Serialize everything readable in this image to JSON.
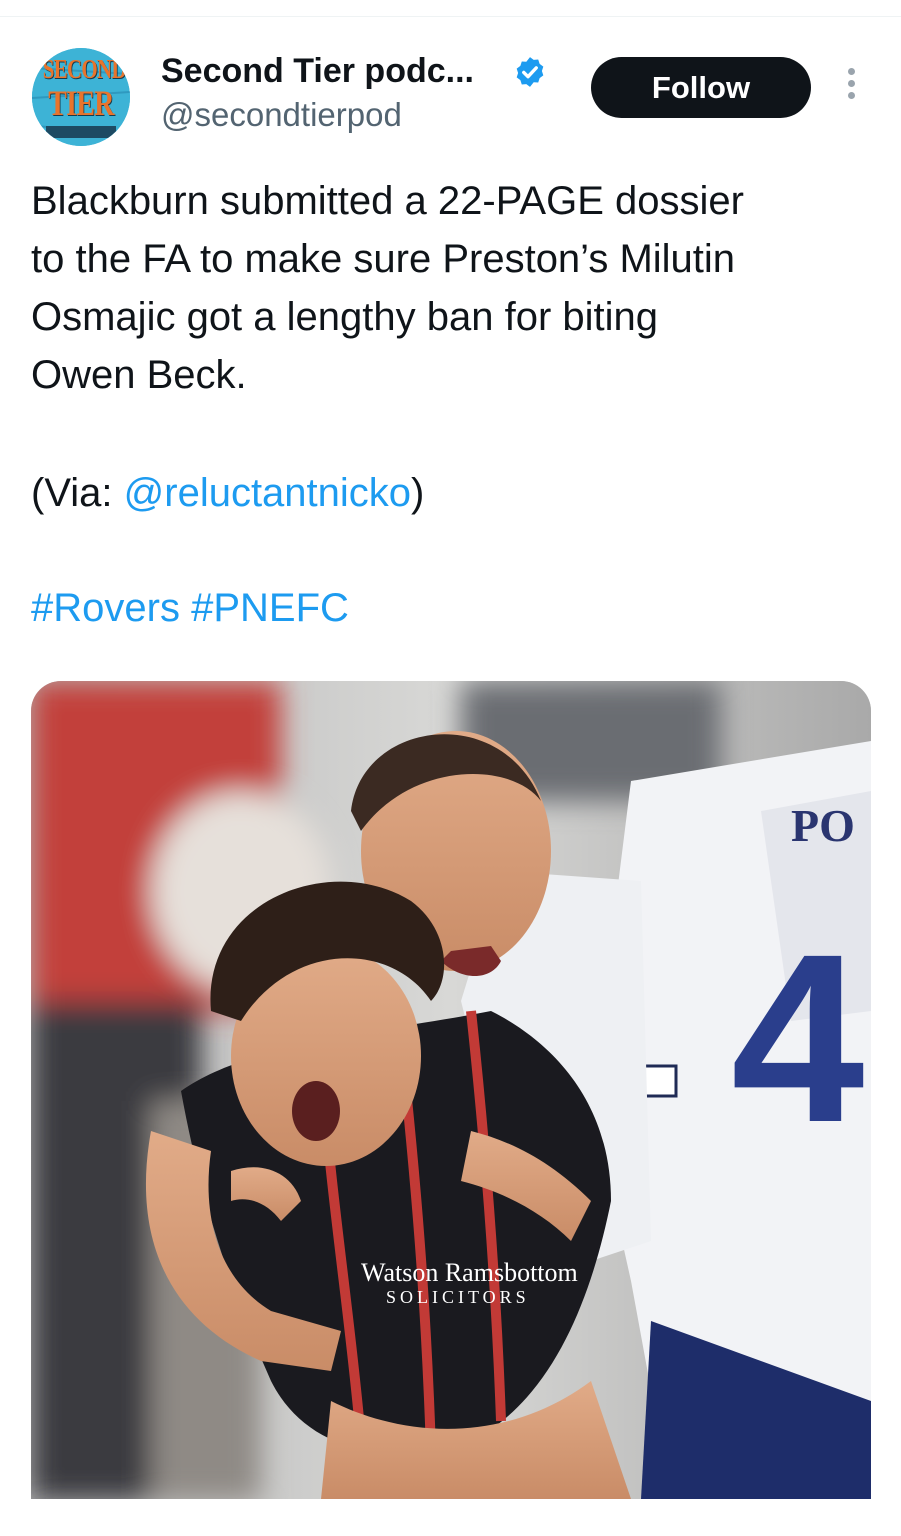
{
  "author": {
    "avatar_text_line1": "SECOND",
    "avatar_text_line2": "TIER",
    "name": "Second Tier podc...",
    "handle": "@secondtierpod",
    "verified": true
  },
  "actions": {
    "follow_label": "Follow"
  },
  "tweet": {
    "line1": "Blackburn submitted a 22-PAGE dossier",
    "line2": "to the FA to make sure Preston’s Milutin",
    "line3": "Osmajic got a lengthy ban for biting",
    "line4": "Owen Beck.",
    "via_prefix": "(Via: ",
    "via_mention": "@reluctantnicko",
    "via_suffix": ")",
    "hashtag1": "#Rovers",
    "hashtag2": "#PNEFC"
  },
  "media": {
    "shirt_text_back": "PO",
    "shirt_number": "4",
    "sponsor_line1": "Watson Ramsbottom",
    "sponsor_line2": "SOLICITORS"
  },
  "colors": {
    "link": "#1d9bf0",
    "text": "#0f1419",
    "secondary": "#536471",
    "follow_bg": "#0f1419"
  }
}
